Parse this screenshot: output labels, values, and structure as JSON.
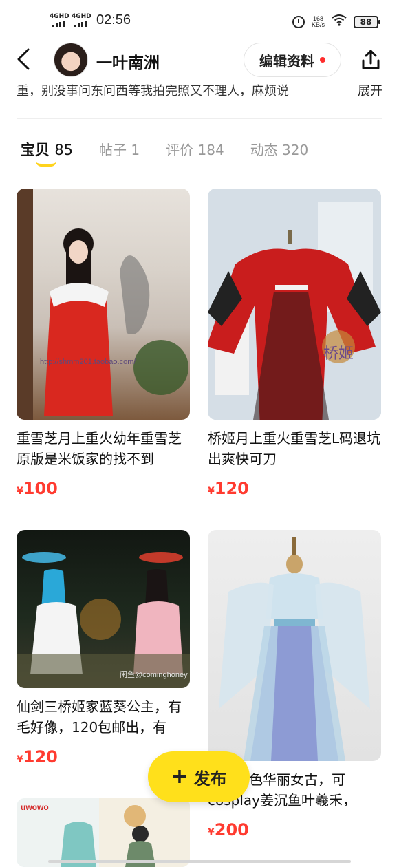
{
  "status_bar": {
    "signal1": "4GHD",
    "signal2": "4GHD",
    "time": "02:56",
    "net_speed_value": "168",
    "net_speed_unit": "KB/s",
    "battery": "88"
  },
  "header": {
    "username": "一叶南洲",
    "edit_label": "编辑资料"
  },
  "bio": {
    "text": "重，别没事问东问西等我拍完照又不理人，麻烦说",
    "more": "展开"
  },
  "tabs": [
    {
      "label": "宝贝",
      "count": "85"
    },
    {
      "label": "帖子",
      "count": "1"
    },
    {
      "label": "评价",
      "count": "184"
    },
    {
      "label": "动态",
      "count": "320"
    }
  ],
  "items": [
    {
      "title": "重雪芝月上重火幼年重雪芝原版是米饭家的找不到",
      "currency": "¥",
      "price": "100",
      "watermark": "http://shmm201.taobao.com/"
    },
    {
      "title": "桥姬月上重火重雪芝L码退坑出爽快可刀",
      "currency": "¥",
      "price": "120",
      "watermark": "桥姬"
    },
    {
      "title": "仙剑三桥姬家蓝葵公主，有毛好像，120包邮出，有",
      "currency": "¥",
      "price": "120",
      "watermark": "闲鱼@cominghoney"
    },
    {
      "title": "闲入蓝色华丽女古，可cosplay姜沉鱼叶羲禾，",
      "currency": "¥",
      "price": "200"
    },
    {
      "title": "",
      "currency": "",
      "price": "",
      "watermark": "uwowo"
    }
  ],
  "publish": {
    "label": "发布"
  },
  "colors": {
    "accent": "#ffe01b",
    "price": "#ff3b30",
    "tab_underline": "#ffd31c"
  }
}
